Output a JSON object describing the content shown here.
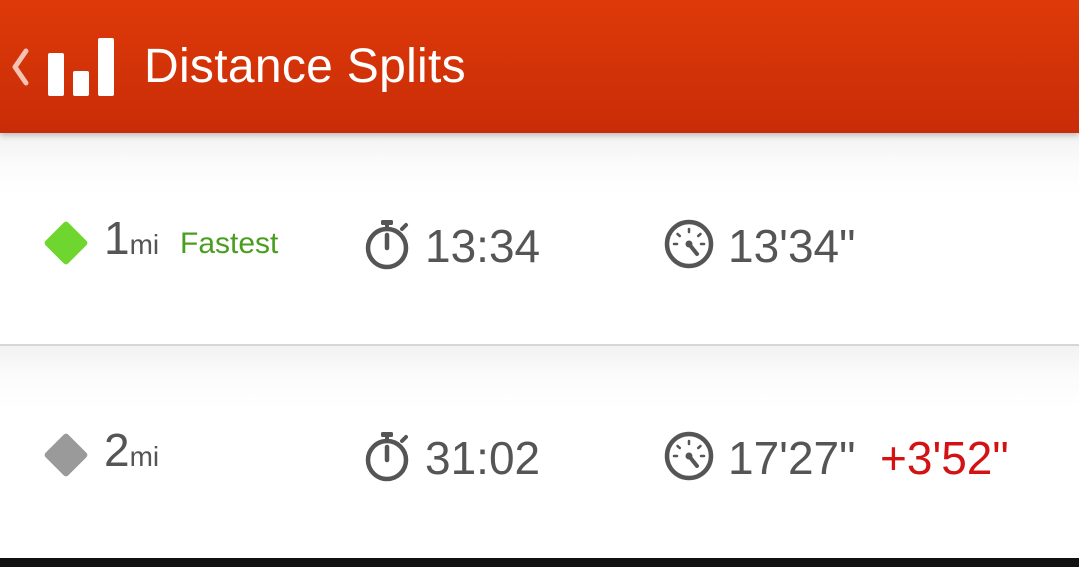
{
  "header": {
    "title": "Distance Splits",
    "accent_color": "#d1320a",
    "back_icon": "chevron-left-icon",
    "app_icon": "bar-chart-icon"
  },
  "splits": [
    {
      "distance": "1",
      "unit": "mi",
      "badge": "Fastest",
      "badge_color": "#4a9e1f",
      "marker_color": "#6fd62f",
      "time": "13:34",
      "pace": "13'34\"",
      "diff": ""
    },
    {
      "distance": "2",
      "unit": "mi",
      "badge": "",
      "marker_color": "#9a9a9a",
      "time": "31:02",
      "pace": "17'27\"",
      "diff": "+3'52\"",
      "diff_color": "#d31313"
    }
  ],
  "icons": {
    "time": "stopwatch-icon",
    "pace": "speedometer-icon"
  }
}
